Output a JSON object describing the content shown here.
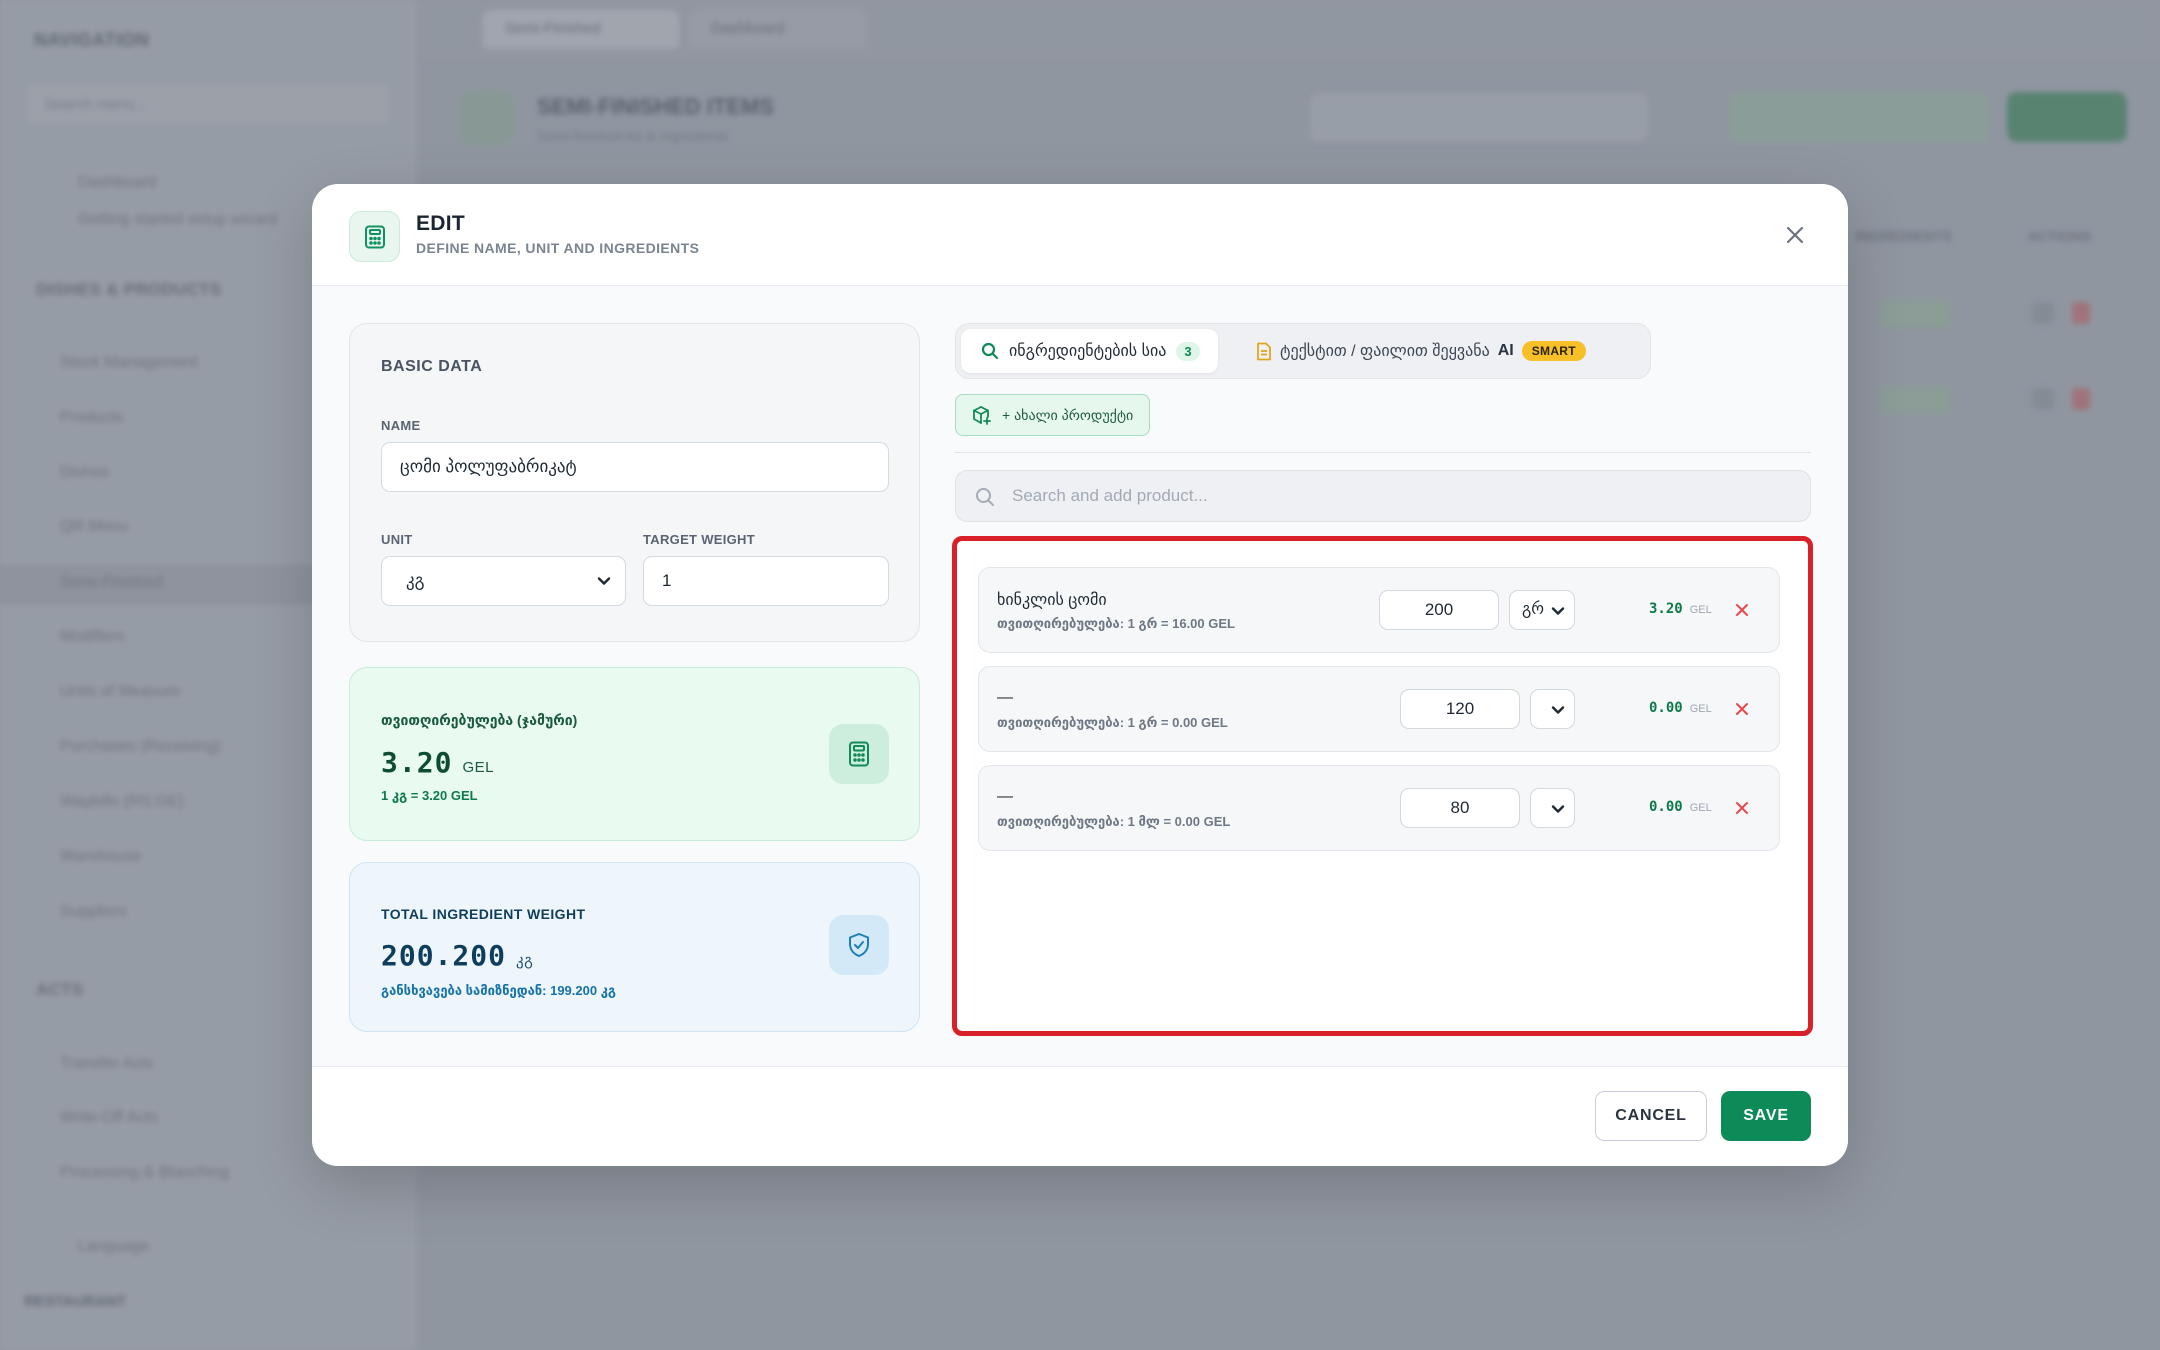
{
  "background": {
    "sidebar": {
      "title": "NAVIGATION",
      "search_placeholder": "Search menu...",
      "top_items": [
        "Dashboard",
        "Getting started setup wizard"
      ],
      "section_dishes": "DISHES & PRODUCTS",
      "dish_items": [
        "Stock Management",
        "Products",
        "Dishes",
        "QR Menu",
        "Semi-Finished",
        "Modifiers",
        "Units of Measure",
        "Purchases (Receiving)",
        "Waybills (RS.GE)",
        "Warehouse",
        "Suppliers"
      ],
      "section_acts": "ACTS",
      "act_items": [
        "Transfer Acts",
        "Write-Off Acts",
        "Processing & Blanching"
      ],
      "language": "Language",
      "user_name": "RESTAURANT"
    },
    "tabs": [
      "Semi-Finished",
      "Dashboard"
    ],
    "page_title": "SEMI-FINISHED ITEMS",
    "page_subtitle": "Semi-finished list & ingredients",
    "table_headers": [
      "INGREDIENTS",
      "ACTIONS"
    ]
  },
  "modal": {
    "title": "EDIT",
    "subtitle": "DEFINE NAME, UNIT AND INGREDIENTS",
    "basic": {
      "section_title": "BASIC DATA",
      "name_label": "NAME",
      "name_value": "ცომი პოლუფაბრიკატ",
      "unit_label": "UNIT",
      "unit_value": "კგ",
      "target_label": "TARGET WEIGHT",
      "target_value": "1"
    },
    "cost_card": {
      "label": "თვითღირებულება (ჯამური)",
      "value": "3.20",
      "unit": "GEL",
      "sub": "1 კგ = 3.20 GEL"
    },
    "weight_card": {
      "label": "TOTAL INGREDIENT WEIGHT",
      "value": "200.200",
      "unit": "კგ",
      "sub": "განსხვავება სამიზნედან: 199.200 კგ"
    },
    "tabs": {
      "ingredients_label": "ინგრედიენტების სია",
      "ingredients_count": "3",
      "ai_label": "ტექსტით / ფაილით შეყვანა",
      "ai_tag": "AI",
      "smart_badge": "SMART"
    },
    "new_product_label": "+ ახალი პროდუქტი",
    "search_placeholder": "Search and add product...",
    "ingredients": [
      {
        "name": "ხინკლის ცომი",
        "cost_line": "თვითღირებულება: 1 გრ = 16.00 GEL",
        "qty": "200",
        "unit": "გრ",
        "price": "3.20",
        "currency": "GEL"
      },
      {
        "name": "—",
        "cost_line": "თვითღირებულება: 1 გრ = 0.00 GEL",
        "qty": "120",
        "unit": "",
        "price": "0.00",
        "currency": "GEL"
      },
      {
        "name": "—",
        "cost_line": "თვითღირებულება: 1 მლ = 0.00 GEL",
        "qty": "80",
        "unit": "",
        "price": "0.00",
        "currency": "GEL"
      }
    ],
    "cancel_label": "CANCEL",
    "save_label": "SAVE"
  },
  "colors": {
    "accent_green": "#0c8a57",
    "highlight_red": "#d92028",
    "smart_yellow": "#f7c028",
    "remove_red": "#e5484d"
  }
}
